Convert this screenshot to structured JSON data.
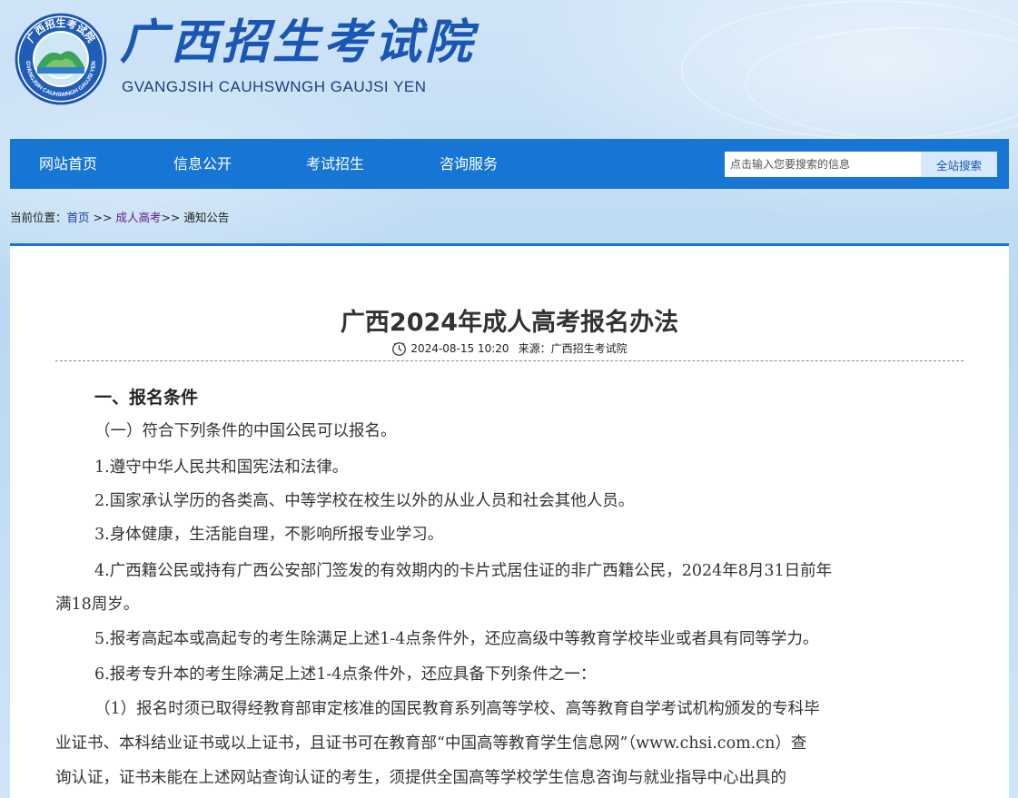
{
  "site": {
    "title_cn": "广西招生考试院",
    "title_en": "GVANGJSIH CAUHSWNGH GAUJSI YEN",
    "logo_text": "广西招生考试院",
    "logo_ring_text": "GVANGJSIH CAUHSWNGH GAUJSI YEN"
  },
  "nav": {
    "items": [
      "网站首页",
      "信息公开",
      "考试招生",
      "咨询服务"
    ],
    "search_placeholder": "点击输入您要搜索的信息",
    "search_button": "全站搜索"
  },
  "breadcrumb": {
    "prefix": "当前位置：",
    "home": "首页",
    "sep1": " >> ",
    "adult": "成人高考",
    "sep2": ">> ",
    "current": "通知公告"
  },
  "article": {
    "title": "广西2024年成人高考报名办法",
    "date": "2024-08-15 10:20",
    "source": "来源：广西招生考试院",
    "lines": [
      "一、报名条件",
      "（一）符合下列条件的中国公民可以报名。",
      "1.遵守中华人民共和国宪法和法律。",
      "2.国家承认学历的各类高、中等学校在校生以外的从业人员和社会其他人员。",
      "3.身体健康，生活能自理，不影响所报专业学习。",
      "4.广西籍公民或持有广西公安部门签发的有效期内的卡片式居住证的非广西籍公民，2024年8月31日前年",
      "满18周岁。",
      "5.报考高起本或高起专的考生除满足上述1-4点条件外，还应高级中等教育学校毕业或者具有同等学力。",
      "6.报考专升本的考生除满足上述1-4点条件外，还应具备下列条件之一：",
      "（1）报名时须已取得经教育部审定核准的国民教育系列高等学校、高等教育自学考试机构颁发的专科毕",
      "业证书、本科结业证书或以上证书，且证书可在教育部“中国高等教育学生信息网”（www.chsi.com.cn）查",
      "询认证，证书未能在上述网站查询认证的考生，须提供全国高等学校学生信息咨询与就业指导中心出具的"
    ]
  },
  "colors": {
    "nav_bg": "#1775d4",
    "title_blue": "#1a56b3",
    "link_home": "#1a3ea8",
    "link_visited": "#5b1a8c"
  }
}
